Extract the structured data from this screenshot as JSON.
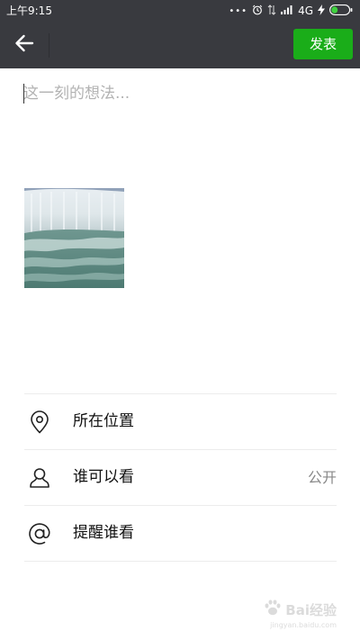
{
  "status_bar": {
    "time": "上午9:15",
    "dots": "•••",
    "network": "4G"
  },
  "header": {
    "back_icon": "back-arrow-icon",
    "publish_label": "发表"
  },
  "composer": {
    "placeholder": "这一刻的想法...",
    "value": ""
  },
  "photo": {
    "subject": "waterfall"
  },
  "options": [
    {
      "icon": "location-pin-icon",
      "label": "所在位置",
      "value": ""
    },
    {
      "icon": "person-icon",
      "label": "谁可以看",
      "value": "公开"
    },
    {
      "icon": "at-sign-icon",
      "label": "提醒谁看",
      "value": ""
    }
  ],
  "watermark": {
    "text": "Bai经验",
    "sub": "jingyan.baidu.com"
  },
  "colors": {
    "bar_background": "#393a3f",
    "accent_green": "#1aad19",
    "divider": "#ececec"
  }
}
